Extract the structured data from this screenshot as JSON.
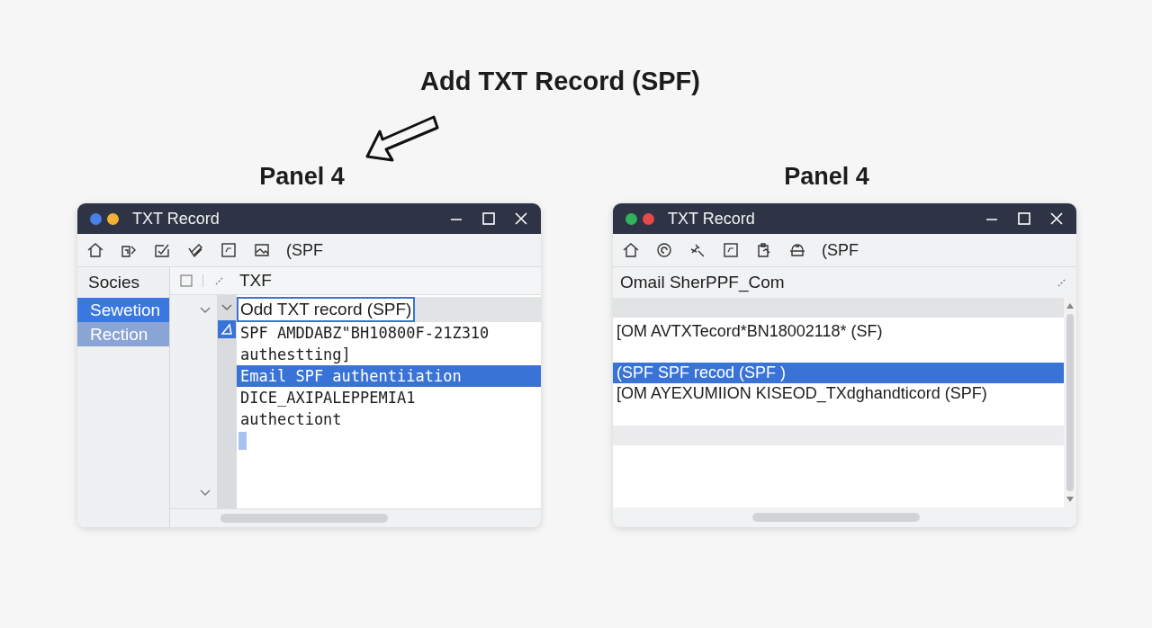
{
  "heading": "Add TXT Record (SPF)",
  "panels": [
    {
      "label": "Panel 4",
      "window": {
        "title": "TXT Record",
        "dots": [
          {
            "color": "#4a80e8"
          },
          {
            "color": "#f2b233"
          }
        ]
      },
      "toolbar": {
        "text": "(SPF"
      },
      "kind": "table",
      "sidebar": {
        "header": "Socies",
        "items": [
          {
            "label": "Sewetion",
            "selected": true,
            "hover": false
          },
          {
            "label": "Rection",
            "selected": false,
            "hover": true
          }
        ]
      },
      "table": {
        "header": "TXF",
        "rows": [
          {
            "lines": [
              "Odd TXT record   (SPF)"
            ],
            "selected": false,
            "focused": true,
            "marker": false
          },
          {
            "lines": [
              "SPF AMDDABZ\"BH10800F-21Z310",
              "authestting]"
            ],
            "selected": false,
            "focused": false,
            "marker": true
          },
          {
            "lines": [
              "Email SPF authentiiation"
            ],
            "selected": true,
            "focused": false,
            "marker": false
          },
          {
            "lines": [
              "DICE_AXIPALEPPEMIA1",
              "authectiont"
            ],
            "selected": false,
            "focused": false,
            "marker": false
          }
        ]
      }
    },
    {
      "label": "Panel 4",
      "window": {
        "title": "TXT Record",
        "dots": [
          {
            "color": "#2fb45a"
          },
          {
            "color": "#e84848"
          }
        ]
      },
      "toolbar": {
        "text": "(SPF"
      },
      "kind": "list",
      "list": {
        "header": "Omail SherPPF_Com",
        "rows": [
          {
            "text": "[OM AVTXTecord*BN18002118* (SF)",
            "selected": false
          },
          {
            "text": "(SPF  SPF  recod (SPF )",
            "selected": true
          },
          {
            "text": "[OM AYEXUMIION KISEOD_TXdghandticord (SPF)",
            "selected": false
          }
        ]
      }
    }
  ]
}
